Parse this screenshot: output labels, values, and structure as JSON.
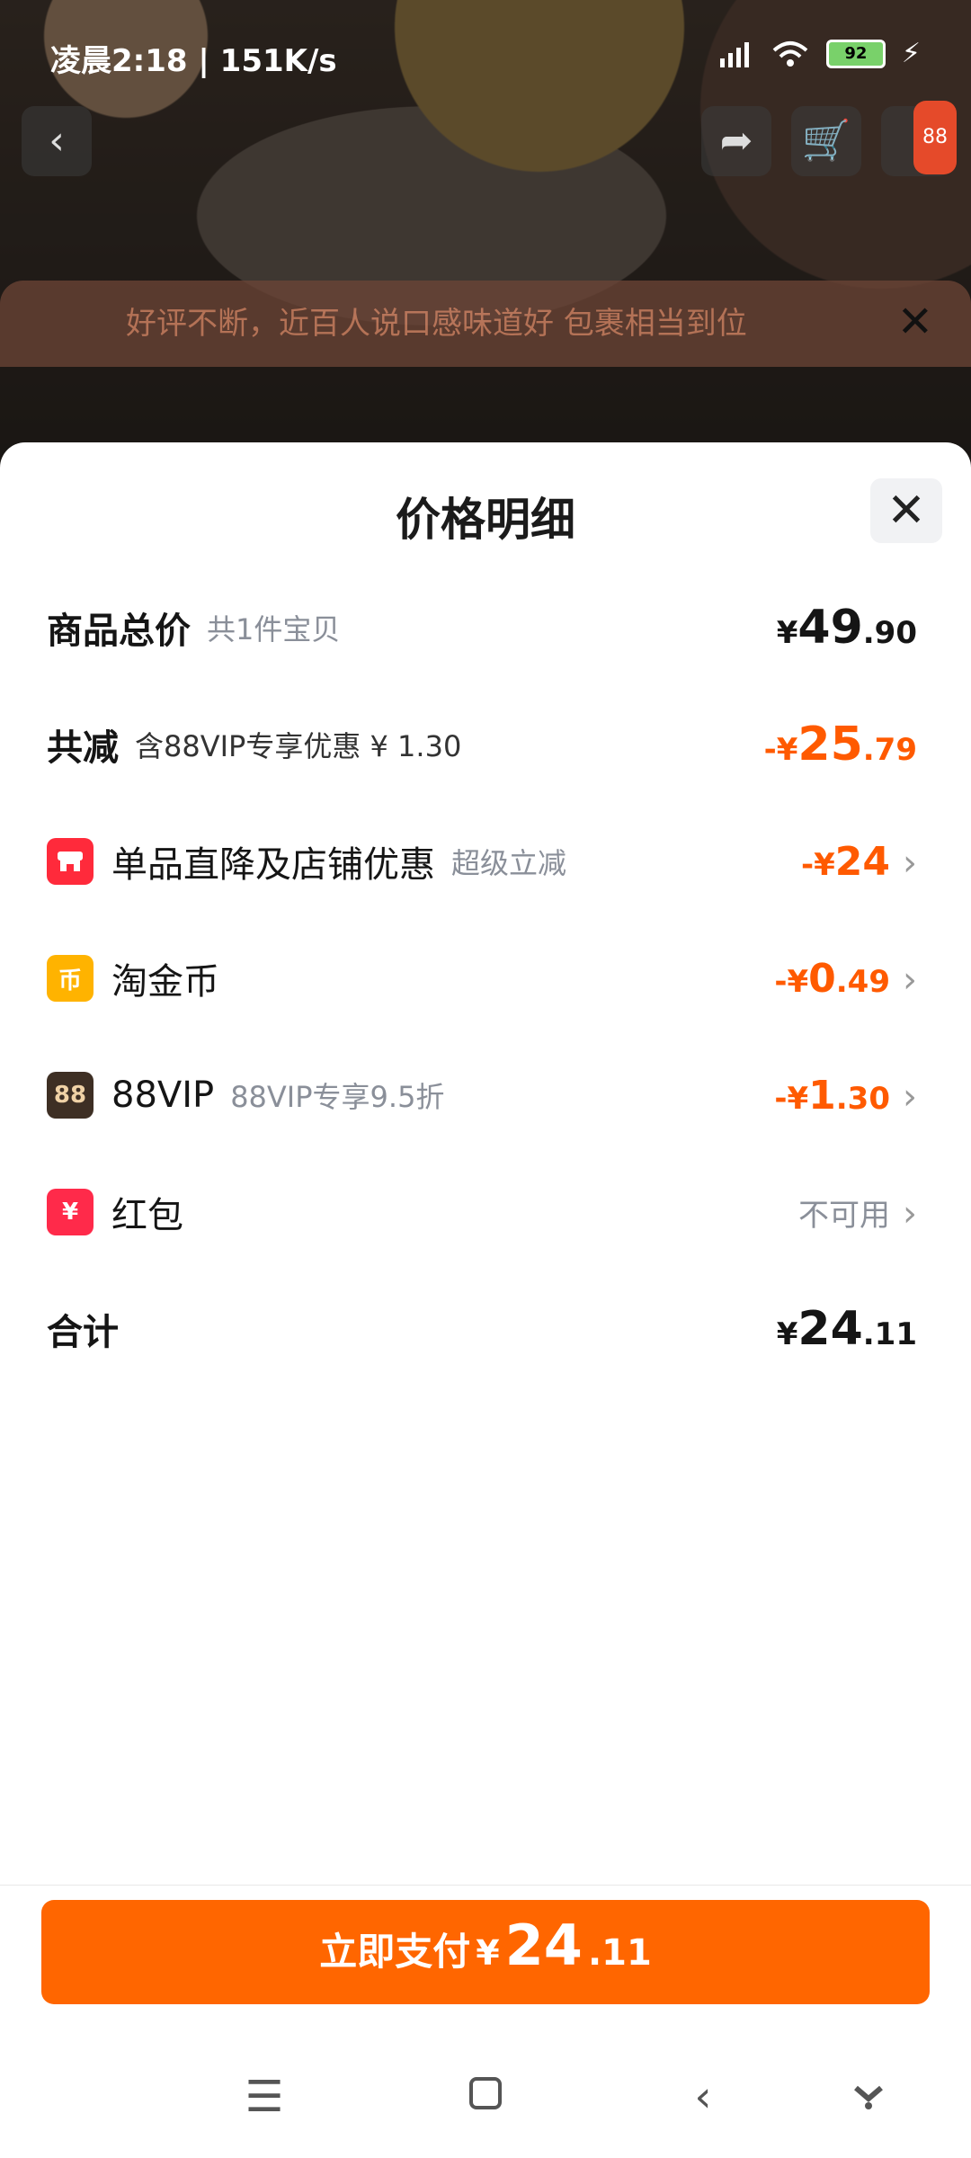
{
  "status": {
    "time_speed": "凌晨2:18 | 151K/s",
    "battery": "92"
  },
  "background": {
    "cart_badge": "88",
    "review_text": "好评不断，近百人说口感味道好 包裹相当到位"
  },
  "sheet": {
    "title": "价格明细",
    "rows": {
      "total": {
        "label": "商品总价",
        "sub": "共1件宝贝",
        "cur": "¥",
        "int": "49",
        "dec": ".90"
      },
      "reduce": {
        "label": "共减",
        "sub": "含88VIP专享优惠 ¥ 1.30",
        "prefix": "-¥",
        "int": "25",
        "dec": ".79"
      },
      "direct": {
        "label": "单品直降及店铺优惠",
        "sub": "超级立减",
        "prefix": "-¥",
        "int": "24"
      },
      "coin": {
        "label": "淘金币",
        "prefix": "-¥",
        "int": "0",
        "dec": ".49"
      },
      "vip": {
        "label": "88VIP",
        "icon_text": "88",
        "sub": "88VIP专享9.5折",
        "prefix": "-¥",
        "int": "1",
        "dec": ".30"
      },
      "redpacket": {
        "label": "红包",
        "value": "不可用"
      },
      "sum": {
        "label": "合计",
        "cur": "¥",
        "int": "24",
        "dec": ".11"
      }
    }
  },
  "pay": {
    "label": "立即支付",
    "cur": "¥",
    "int": "24",
    "dec": ".11"
  },
  "icons": [
    "back-icon",
    "share-icon",
    "cart-icon",
    "close-icon",
    "store-icon",
    "coin-icon",
    "vip-icon",
    "red-packet-icon",
    "chevron-right-icon",
    "menu-icon",
    "home-icon",
    "nav-back-icon",
    "assistant-icon"
  ]
}
